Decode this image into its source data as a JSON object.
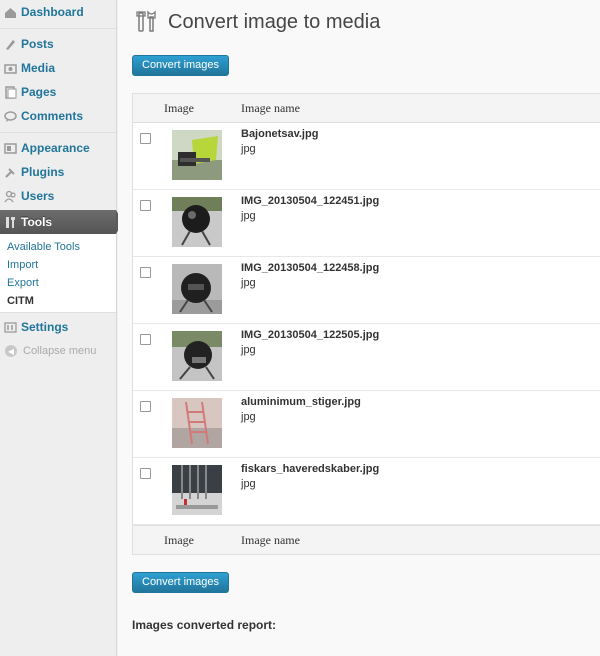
{
  "sidebar": {
    "items": [
      {
        "label": "Dashboard",
        "icon": "dashboard-icon"
      },
      {
        "label": "Posts",
        "icon": "posts-icon"
      },
      {
        "label": "Media",
        "icon": "media-icon"
      },
      {
        "label": "Pages",
        "icon": "pages-icon"
      },
      {
        "label": "Comments",
        "icon": "comments-icon"
      },
      {
        "label": "Appearance",
        "icon": "appearance-icon"
      },
      {
        "label": "Plugins",
        "icon": "plugins-icon"
      },
      {
        "label": "Users",
        "icon": "users-icon"
      },
      {
        "label": "Tools",
        "icon": "tools-icon"
      },
      {
        "label": "Settings",
        "icon": "settings-icon"
      }
    ],
    "submenu": [
      "Available Tools",
      "Import",
      "Export",
      "CITM"
    ],
    "collapse": "Collapse menu"
  },
  "page": {
    "title": "Convert image to media",
    "convert_button": "Convert images",
    "report_label": "Images converted report:"
  },
  "table": {
    "headers": {
      "image": "Image",
      "name": "Image name"
    },
    "rows": [
      {
        "name": "Bajonetsav.jpg",
        "type": "jpg"
      },
      {
        "name": "IMG_20130504_122451.jpg",
        "type": "jpg"
      },
      {
        "name": "IMG_20130504_122458.jpg",
        "type": "jpg"
      },
      {
        "name": "IMG_20130504_122505.jpg",
        "type": "jpg"
      },
      {
        "name": "aluminimum_stiger.jpg",
        "type": "jpg"
      },
      {
        "name": "fiskars_haveredskaber.jpg",
        "type": "jpg"
      }
    ]
  },
  "colors": {
    "link": "#21759b",
    "button": "#21759b",
    "active_menu": "#5b5b5b"
  }
}
